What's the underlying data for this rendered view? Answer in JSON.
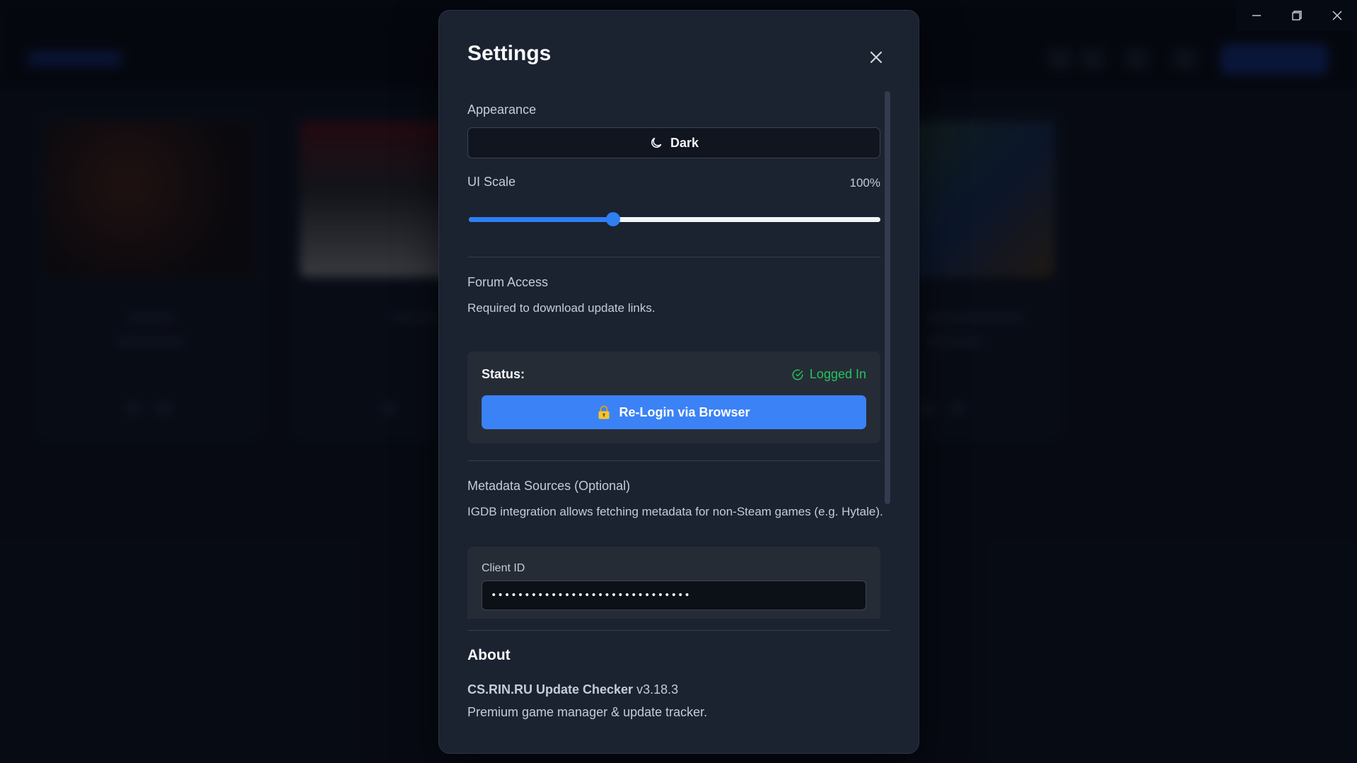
{
  "window": {
    "minimize_icon": "minimize-icon",
    "restore_icon": "restore-icon",
    "close_icon": "close-icon"
  },
  "settings": {
    "title": "Settings",
    "appearance": {
      "label": "Appearance",
      "theme_button": "Dark",
      "theme_icon": "moon-icon"
    },
    "ui_scale": {
      "label": "UI Scale",
      "value_text": "100%",
      "slider_fraction": 0.35
    },
    "forum_access": {
      "heading": "Forum Access",
      "description": "Required to download update links.",
      "status_label": "Status:",
      "status_value": "Logged In",
      "status_color": "#22c55e",
      "relogin_button": "Re-Login via Browser"
    },
    "metadata": {
      "heading": "Metadata Sources (Optional)",
      "description": "IGDB integration allows fetching metadata for non-Steam games (e.g. Hytale).",
      "client_id_label": "Client ID",
      "client_id_value": "••••••••••••••••••••••••••••••"
    },
    "about": {
      "heading": "About",
      "app_name": "CS.RIN.RU Update Checker",
      "version": "v3.18.3",
      "tagline": "Premium game manager & update tracker."
    }
  },
  "colors": {
    "accent": "#3b82f6",
    "success": "#22c55e",
    "modal_bg": "#1b2230"
  }
}
